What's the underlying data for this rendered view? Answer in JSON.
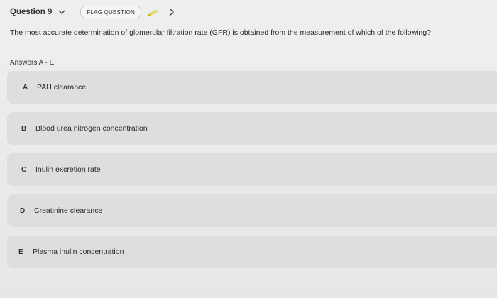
{
  "header": {
    "question_label": "Question 9",
    "flag_label": "FLAG QUESTION",
    "icons": {
      "dropdown": "chevron-down-icon",
      "flag": "pencil-icon",
      "next": "chevron-right-icon"
    },
    "colors": {
      "pencil": "#e2d44a"
    }
  },
  "question": {
    "text": "The most accurate determination of glomerular filtration rate (GFR) is obtained from the measurement of which of the following?"
  },
  "answers": {
    "label": "Answers A - E",
    "options": [
      {
        "letter": "A",
        "text": "PAH clearance"
      },
      {
        "letter": "B",
        "text": "Blood urea nitrogen concentration"
      },
      {
        "letter": "C",
        "text": "Inulin excretion rate"
      },
      {
        "letter": "D",
        "text": "Creatinine clearance"
      },
      {
        "letter": "E",
        "text": "Plasma inulin concentration"
      }
    ]
  }
}
